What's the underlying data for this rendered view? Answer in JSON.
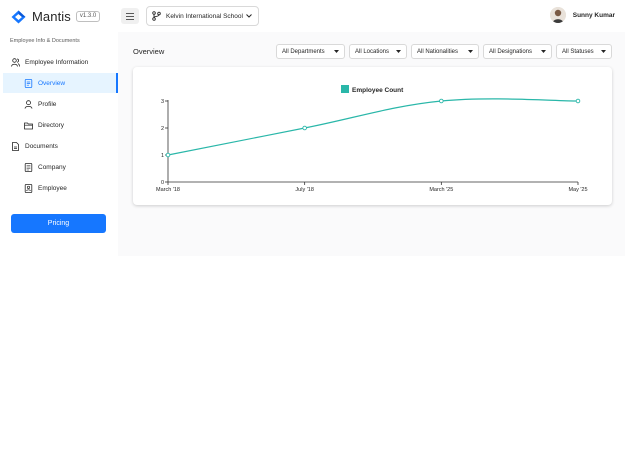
{
  "app": {
    "name": "Mantis",
    "version": "v1.3.0"
  },
  "header": {
    "school": "Kelvin International School",
    "user_name": "Sunny Kumar"
  },
  "sidebar": {
    "caption": "Employee Info & Documents",
    "items": [
      {
        "label": "Employee Information",
        "icon": "users-icon"
      },
      {
        "label": "Overview",
        "icon": "file-icon"
      },
      {
        "label": "Profile",
        "icon": "user-icon"
      },
      {
        "label": "Directory",
        "icon": "folder-icon"
      },
      {
        "label": "Documents",
        "icon": "document-icon"
      },
      {
        "label": "Company",
        "icon": "file-text-icon"
      },
      {
        "label": "Employee",
        "icon": "contact-icon"
      }
    ],
    "pricing_label": "Pricing"
  },
  "main": {
    "title": "Overview",
    "filters": [
      "All Departments",
      "All Locations",
      "All Nationalities",
      "All Designations",
      "All Statuses"
    ]
  },
  "colors": {
    "accent": "#1677ff",
    "series": "#2ab7a9"
  },
  "chart_data": {
    "type": "line",
    "categories": [
      "March '18",
      "July '18",
      "March '25",
      "May '25"
    ],
    "series": [
      {
        "name": "Employee Count",
        "values": [
          1,
          2,
          3,
          3
        ]
      }
    ],
    "ylim": [
      0,
      3
    ],
    "yticks": [
      "0",
      "1",
      "2",
      "3"
    ],
    "legend": "top-center",
    "grid": false
  }
}
